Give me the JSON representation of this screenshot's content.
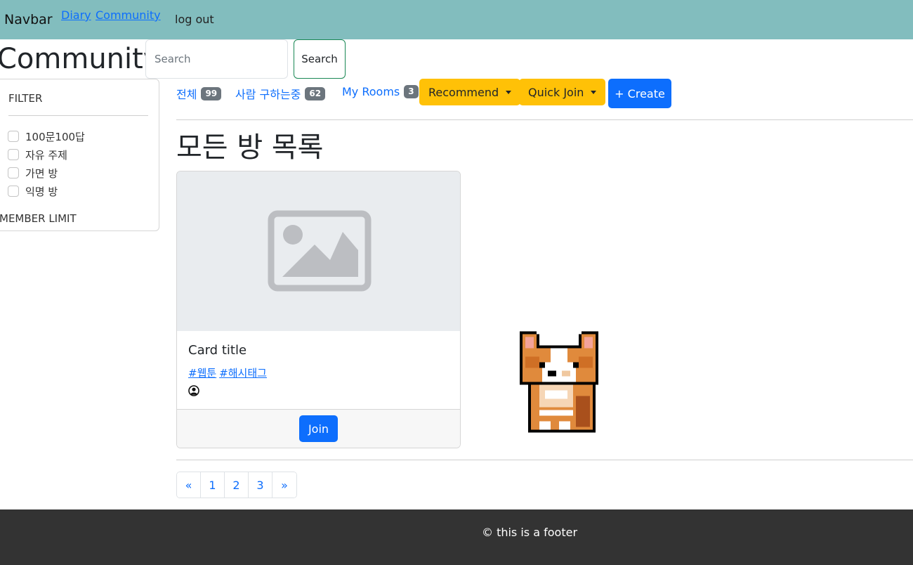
{
  "navbar": {
    "brand": "Navbar",
    "links": [
      {
        "label": "Diary"
      },
      {
        "label": "Community"
      }
    ],
    "logout": "log out"
  },
  "header": {
    "title": "Community",
    "search_placeholder": "Search",
    "search_button": "Search"
  },
  "filter": {
    "title": "FILTER",
    "options": [
      {
        "label": "100문100답",
        "checked": false
      },
      {
        "label": "자유 주제",
        "checked": false
      },
      {
        "label": "가면 방",
        "checked": false
      },
      {
        "label": "익명 방",
        "checked": false
      }
    ],
    "member_limit": "MEMBER LIMIT"
  },
  "tabs": [
    {
      "label": "전체",
      "count": "99"
    },
    {
      "label": "사람 구하는중",
      "count": "62"
    },
    {
      "label": "My Rooms",
      "count": "3"
    }
  ],
  "actions": {
    "recommend": "Recommend",
    "quick_join": "Quick Join",
    "create": "+ Create",
    "colors": {
      "dropdown": "#ffc107",
      "primary": "#0d6efd"
    }
  },
  "section_title": "모든 방 목록",
  "cards": [
    {
      "title": "Card title",
      "tags": [
        "#웹툰",
        "#해시태그"
      ],
      "join": "Join",
      "image_icon": "image-placeholder-icon",
      "user_icon": "user-circle-icon"
    }
  ],
  "mascot": "corgi-pixel-art",
  "pagination": [
    "«",
    "1",
    "2",
    "3",
    "»"
  ],
  "footer": "© this is a footer"
}
